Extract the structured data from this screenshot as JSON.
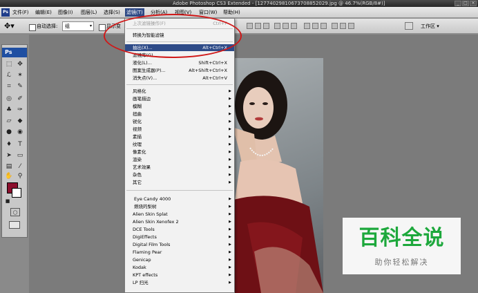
{
  "window": {
    "title": "Adobe Photoshop CS3 Extended - [12774029810673708852029.jpg @ 46.7%(RGB/8#)]"
  },
  "menubar": {
    "logo": "Ps",
    "items": [
      "文件(F)",
      "编辑(E)",
      "图像(I)",
      "图层(L)",
      "选择(S)",
      "滤镜(T)",
      "分析(A)",
      "视图(V)",
      "窗口(W)",
      "帮助(H)"
    ]
  },
  "options": {
    "auto_select_label": "自动选择:",
    "auto_select_value": "组",
    "show_transform_label": "显示变",
    "workspace_label": "工作区 ▾"
  },
  "tools": {
    "header": "Ps"
  },
  "filter_menu": {
    "top_items": [
      {
        "label": "上次滤镜操作(F)",
        "shortcut": "Ctrl+F",
        "disabled": true
      },
      {
        "label": "转换为智能滤镜",
        "shortcut": "",
        "disabled": false
      }
    ],
    "special_items": [
      {
        "label": "抽出(X)...",
        "shortcut": "Alt+Ctrl+X",
        "highlighted": true
      },
      {
        "label": "滤镜库(G)...",
        "shortcut": "",
        "highlighted": false
      },
      {
        "label": "液化(L)...",
        "shortcut": "Shift+Ctrl+X",
        "highlighted": false
      },
      {
        "label": "图案生成器(P)...",
        "shortcut": "Alt+Shift+Ctrl+X",
        "highlighted": false
      },
      {
        "label": "消失点(V)...",
        "shortcut": "Alt+Ctrl+V",
        "highlighted": false
      }
    ],
    "filter_groups": [
      "风格化",
      "画笔描边",
      "模糊",
      "扭曲",
      "锐化",
      "视频",
      "素描",
      "纹理",
      "像素化",
      "渲染",
      "艺术效果",
      "杂色",
      "其它"
    ],
    "plugins": [
      "Eye Candy 4000",
      "燃烧的梨树",
      "Alien Skin Splat",
      "Alien Skin Xenofex 2",
      "DCE Tools",
      "DigiEffects",
      "Digital Film Tools",
      "Flaming Pear",
      "Genicap",
      "Kodak",
      "KPT effects",
      "LP 扫光"
    ]
  },
  "watermark": {
    "title": "百科全说",
    "subtitle": "助你轻松解决"
  },
  "colors": {
    "foreground": "#8b0f2d",
    "background": "#ffffff",
    "menu_highlight": "#2e4b88",
    "annotation": "#d01818",
    "watermark_green": "#1da83c"
  }
}
